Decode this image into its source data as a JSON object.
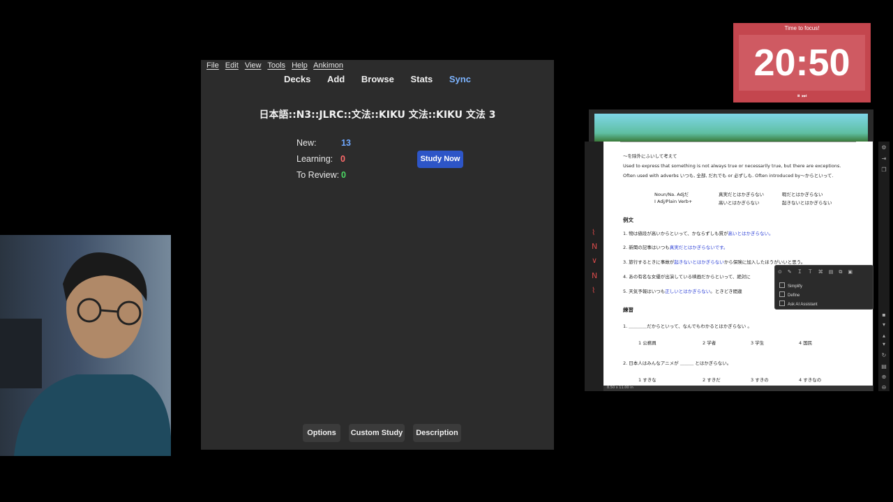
{
  "anki": {
    "menu": [
      "File",
      "Edit",
      "View",
      "Tools",
      "Help",
      "Ankimon"
    ],
    "toolbar": {
      "decks": "Decks",
      "add": "Add",
      "browse": "Browse",
      "stats": "Stats",
      "sync": "Sync"
    },
    "deck_title": "日本語::N3::JLRC::文法::KIKU 文法::KIKU 文法 3",
    "stats": {
      "new_label": "New:",
      "new_value": "13",
      "learning_label": "Learning:",
      "learning_value": "0",
      "review_label": "To Review:",
      "review_value": "0"
    },
    "study_button": "Study Now",
    "bottom_buttons": {
      "options": "Options",
      "custom_study": "Custom Study",
      "description": "Description"
    },
    "colors": {
      "new": "#6fa8ff",
      "learning": "#ff6b6b",
      "review": "#4cd964",
      "accent": "#2d55c7"
    }
  },
  "timer": {
    "label": "Time to focus!",
    "time": "20:50",
    "controls": "⏸ ⏭"
  },
  "pdf": {
    "heading": "〜を除外にふいして考えて",
    "desc1": "Used to express that something is not always true or necessarily true,   but there are exceptions.",
    "desc2": "Often used with adverbs いつも, 全部, だれでも or 必ずしも. Often introduced by〜からといって.",
    "form1_left": "Noun/Na. Adjだ",
    "form1_mid": "真実だとはかぎらない",
    "form1_right": "暇だとはかぎらない",
    "form2_left": "I Adj/Plain Verb+",
    "form2_mid": "高いとはかぎらない",
    "form2_right": "起きないとはかぎらない",
    "examples_title": "例文",
    "ex1_a": "1. 物は値段が高いからといって、かならずしも質が",
    "ex1_b": "高いとはかぎらない。",
    "ex2_a": "2. 新聞の記事はいつも",
    "ex2_b": "真実だとはかぎらないです。",
    "ex3_a": "3. 旅行するときに事故が",
    "ex3_b": "起きないとはかぎらない",
    "ex3_c": "から保険に加入したほうがいいと思う。",
    "ex4": "4. あの有名な女優が出演している映画だからといって、絶対に",
    "ex5_a": "5. 天気予報はいつも",
    "ex5_b": "正しいとはかぎらない",
    "ex5_c": "。ときどき間違",
    "practice_title": "練習",
    "q1": "1. ＿＿＿＿だからといって、なんでもわかるとはかぎらない 。",
    "q1_opts": [
      "1 公務員",
      "2 学者",
      "3 学生",
      "4 国民"
    ],
    "q2": "2. 日本人はみんなアニメが ＿＿＿ とはかぎらない。",
    "q2_opts": [
      "1 すきな",
      "2 すきだ",
      "3 すきの",
      "4 すきなの"
    ],
    "footer": "8.50 x 11.00 in"
  },
  "context_menu": {
    "toolbar_icons": "⊙✎ＩＴ⌘▤⧉▣",
    "items": [
      "Simplify",
      "Define",
      "Ask AI Assistant"
    ]
  }
}
